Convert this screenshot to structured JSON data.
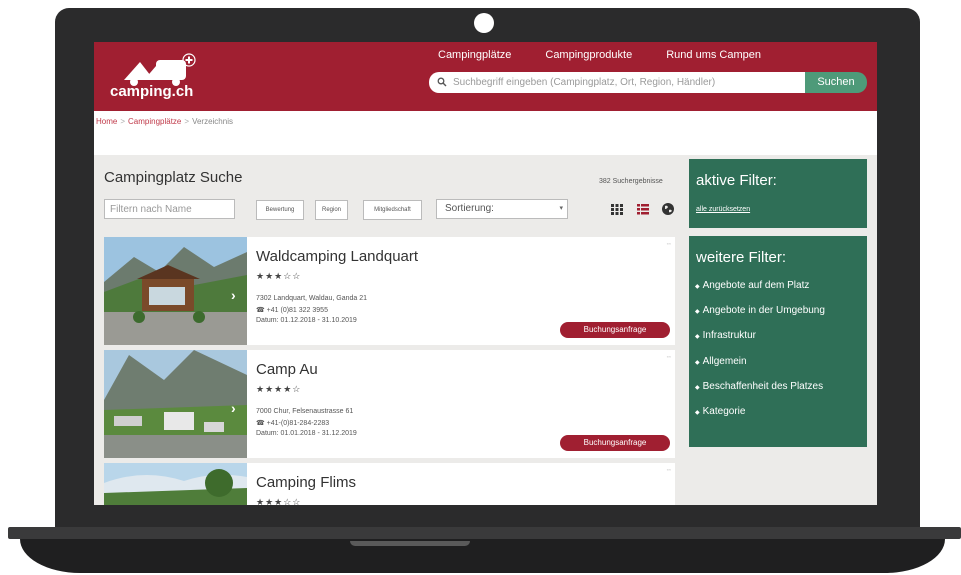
{
  "header": {
    "logo_text": "camping.ch",
    "nav": [
      "Campingplätze",
      "Campingprodukte",
      "Rund ums Campen"
    ],
    "search_placeholder": "Suchbegriff eingeben (Campingplatz, Ort, Region, Händler)",
    "search_button": "Suchen"
  },
  "breadcrumb": {
    "home": "Home",
    "section": "Campingplätze",
    "current": "Verzeichnis",
    "separator": ">"
  },
  "page": {
    "title": "Campingplatz Suche",
    "results_count": "382 Suchergebnisse"
  },
  "filters": {
    "name_placeholder": "Filtern nach Name",
    "chips": [
      "Bewertung",
      "Region",
      "Mitgliedschaft"
    ],
    "sort_label": "Sortierung:"
  },
  "results": [
    {
      "title": "Waldcamping Landquart",
      "stars": "★★★☆☆",
      "address": "7302 Landquart, Waldau, Ganda 21",
      "phone": "☎ +41 (0)81 322 3955",
      "date": "Datum: 01.12.2018 - 31.10.2019",
      "button": "Buchungsanfrage"
    },
    {
      "title": "Camp Au",
      "stars": "★★★★☆",
      "address": "7000 Chur, Felsenaustrasse 61",
      "phone": "☎ +41-(0)81-284-2283",
      "date": "Datum: 01.01.2018 - 31.12.2019",
      "button": "Buchungsanfrage"
    },
    {
      "title": "Camping Flims",
      "stars": "★★★☆☆"
    }
  ],
  "sidebar": {
    "active_title": "aktive Filter:",
    "reset_link": "alle zurücksetzen",
    "more_title": "weitere Filter:",
    "items": [
      "Angebote auf dem Platz",
      "Angebote in der Umgebung",
      "Infrastruktur",
      "Allgemein",
      "Beschaffenheit des Platzes",
      "Kategorie"
    ]
  },
  "colors": {
    "brand_red": "#a01f31",
    "sidebar_green": "#2f6f57",
    "search_green": "#4e9a79",
    "panel_bg": "#ecebe9"
  },
  "icons": [
    "camper-logo-icon",
    "swiss-cross-icon",
    "search-icon",
    "grid-view-icon",
    "list-view-icon",
    "map-view-icon",
    "chevron-right-icon",
    "phone-icon",
    "bullet-icon"
  ]
}
